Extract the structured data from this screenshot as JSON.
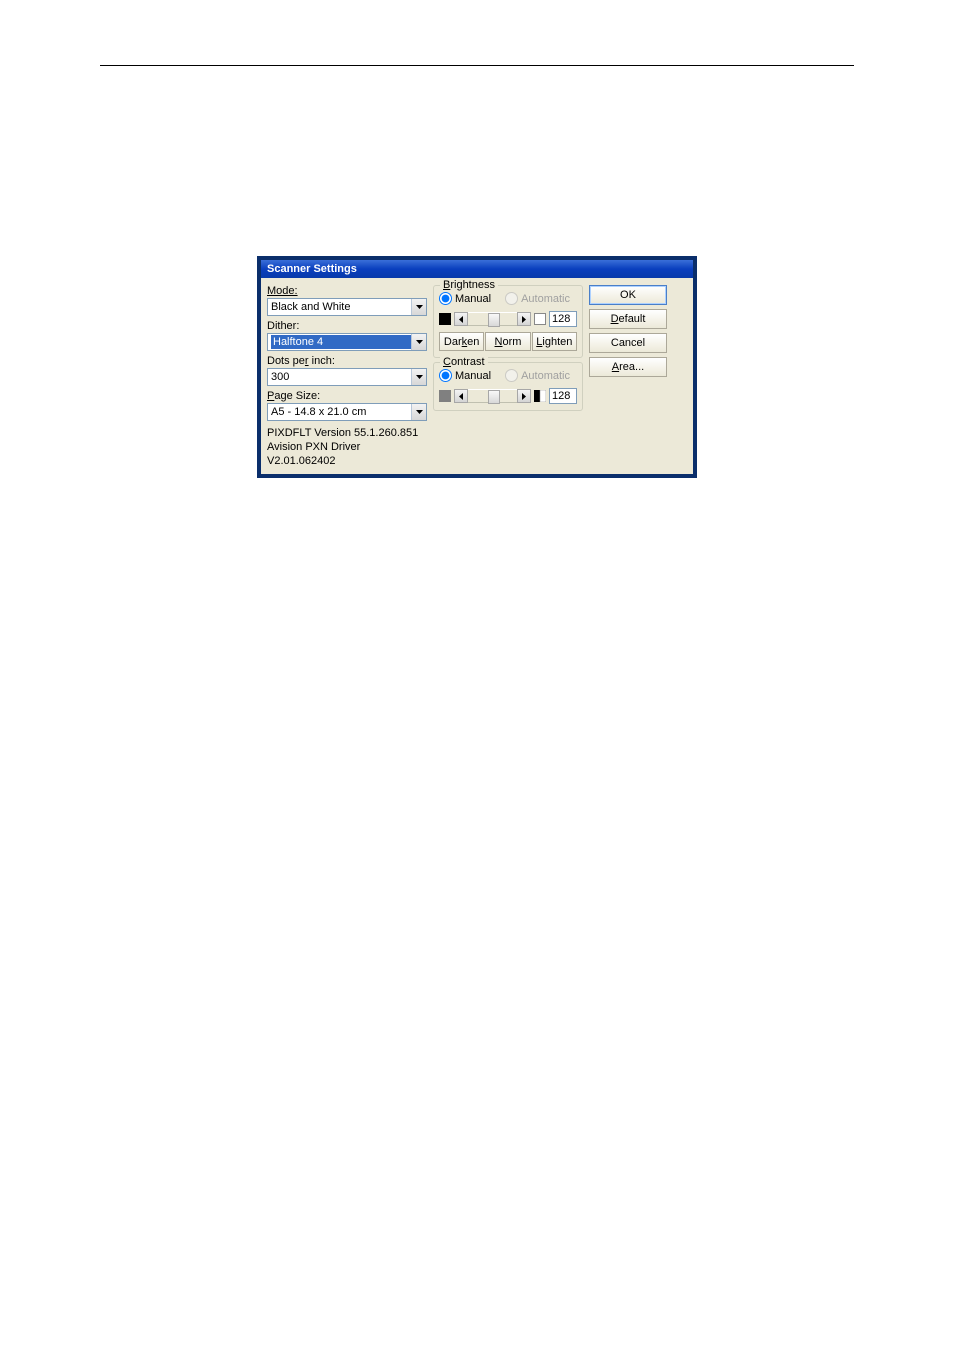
{
  "dialog": {
    "title": "Scanner Settings",
    "left": {
      "mode_label": "Mode:",
      "mode_value": "Black and White",
      "dither_label": "Dither:",
      "dither_value": "Halftone 4",
      "dpi_label_pre": "Dots pe",
      "dpi_label_u": "r",
      "dpi_label_post": " inch:",
      "dpi_value": "300",
      "page_label_u": "P",
      "page_label_post": "age Size:",
      "page_value": "A5 - 14.8 x 21.0 cm",
      "version1": "PIXDFLT Version 55.1.260.851",
      "version2": "Avision PXN Driver V2.01.062402"
    },
    "brightness": {
      "legend_u": "B",
      "legend_post": "rightness",
      "manual": "Manual",
      "automatic": "Automatic",
      "value": "128",
      "darken_pre": "Dar",
      "darken_u": "k",
      "darken_post": "en",
      "norm_u": "N",
      "norm_post": "orm",
      "lighten_u": "L",
      "lighten_post": "ighten"
    },
    "contrast": {
      "legend_u": "C",
      "legend_post": "ontrast",
      "manual": "Manual",
      "automatic": "Automatic",
      "value": "128"
    },
    "buttons": {
      "ok": "OK",
      "default_u": "D",
      "default_post": "efault",
      "cancel": "Cancel",
      "area_u": "A",
      "area_post": "rea..."
    }
  }
}
